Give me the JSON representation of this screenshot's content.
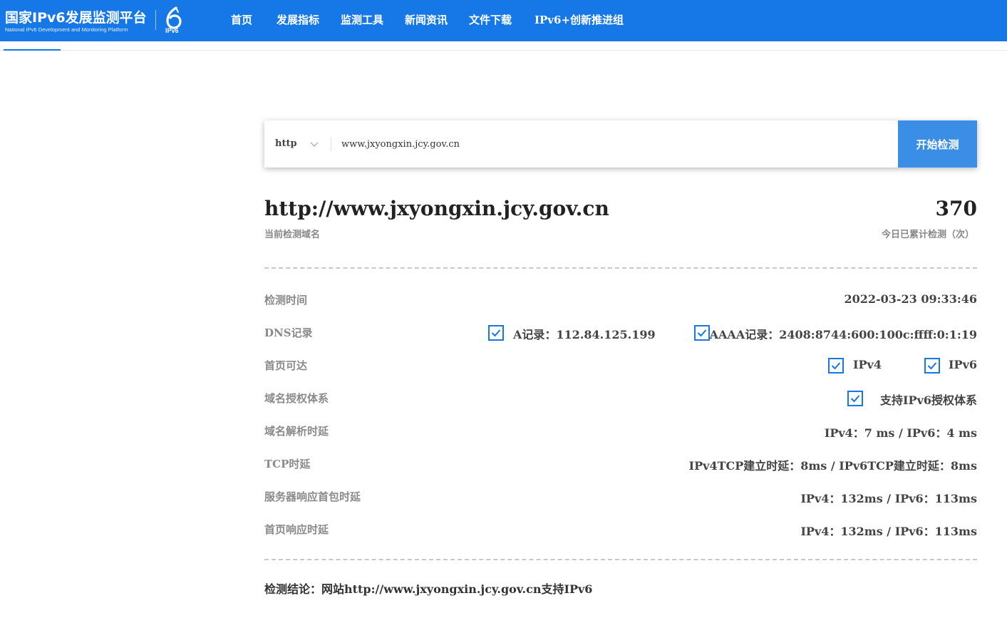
{
  "header": {
    "logo_title": "国家IPv6发展监测平台",
    "logo_subtitle": "National IPv6 Development and Monitoring Platform",
    "logo_badge": "IPv6",
    "nav": [
      "首页",
      "发展指标",
      "监测工具",
      "新闻资讯",
      "文件下载",
      "IPv6+创新推进组"
    ]
  },
  "search": {
    "protocol": "http",
    "url_value": "www.jxyongxin.jcy.gov.cn",
    "button_label": "开始检测"
  },
  "summary": {
    "domain": "http://www.jxyongxin.jcy.gov.cn",
    "domain_caption": "当前检测域名",
    "count": "370",
    "count_caption": "今日已累计检测（次）"
  },
  "rows": {
    "time": {
      "label": "检测时间",
      "value": "2022-03-23 09:33:46"
    },
    "dns": {
      "label": "DNS记录",
      "a_record": "A记录：112.84.125.199",
      "aaaa_record": "AAAA记录：2408:8744:600:100c:ffff:0:1:19"
    },
    "reach": {
      "label": "首页可达",
      "ipv4": "IPv4",
      "ipv6": "IPv6"
    },
    "auth": {
      "label": "域名授权体系",
      "value": "支持IPv6授权体系"
    },
    "resolve": {
      "label": "域名解析时延",
      "value": "IPv4：7 ms / IPv6：4 ms"
    },
    "tcp": {
      "label": "TCP时延",
      "value": "IPv4TCP建立时延：8ms / IPv6TCP建立时延：8ms"
    },
    "first_packet": {
      "label": "服务器响应首包时延",
      "value": "IPv4：132ms / IPv6：113ms"
    },
    "home_resp": {
      "label": "首页响应时延",
      "value": "IPv4：132ms / IPv6：113ms"
    }
  },
  "conclusion": "检测结论：网站http://www.jxyongxin.jcy.gov.cn支持IPv6",
  "colors": {
    "brand": "#1677e6",
    "button": "#3a8ee6",
    "check": "#1677e6"
  }
}
